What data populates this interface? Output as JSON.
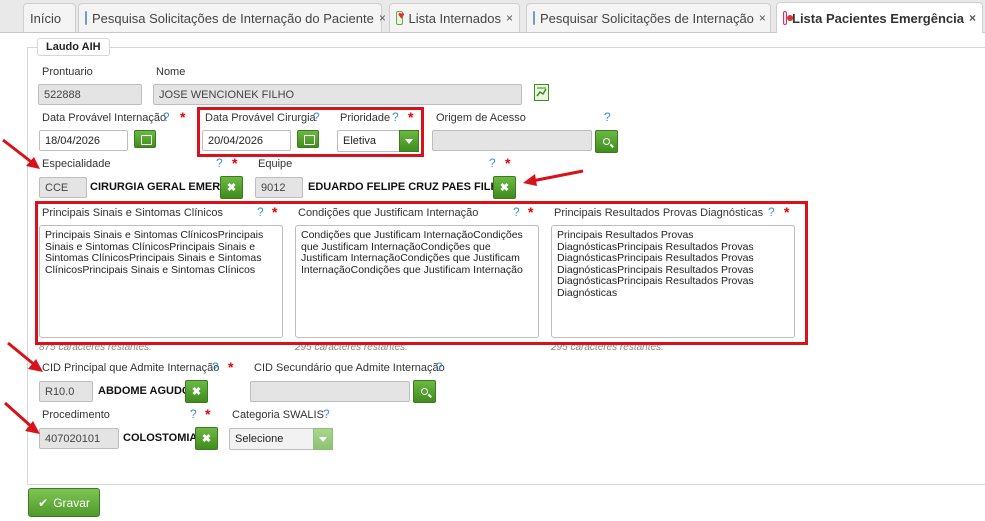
{
  "tabs": [
    {
      "label": "Início"
    },
    {
      "label": "Pesquisa Solicitações de Internação do Paciente",
      "close": "×"
    },
    {
      "label": "Lista Internados",
      "close": "×"
    },
    {
      "label": "Pesquisar Solicitações de Internação",
      "close": "×"
    },
    {
      "label": "Lista Pacientes Emergência",
      "close": "×"
    }
  ],
  "form": {
    "legend": "Laudo AIH",
    "prontuario": {
      "label": "Prontuario",
      "value": "522888"
    },
    "nome": {
      "label": "Nome",
      "value": "JOSE WENCIONEK FILHO"
    },
    "data_internacao": {
      "label": "Data Provável Internação",
      "value": "18/04/2026"
    },
    "data_cirurgia": {
      "label": "Data Provável Cirurgia",
      "value": "20/04/2026"
    },
    "prioridade": {
      "label": "Prioridade",
      "value": "Eletiva"
    },
    "origem": {
      "label": "Origem de Acesso",
      "value": ""
    },
    "especialidade": {
      "label": "Especialidade",
      "code": "CCE",
      "name": "CIRURGIA GERAL EMERG"
    },
    "equipe": {
      "label": "Equipe",
      "code": "9012",
      "name": "EDUARDO FELIPE CRUZ PAES FILHO"
    },
    "sinais": {
      "label": "Principais Sinais e Sintomas Clínicos",
      "value": "Principais Sinais e Sintomas ClínicosPrincipais Sinais e Sintomas ClínicosPrincipais Sinais e Sintomas ClínicosPrincipais Sinais e Sintomas ClínicosPrincipais Sinais e Sintomas Clínicos",
      "chars": "875 caracteres restantes."
    },
    "condicoes": {
      "label": "Condições que Justificam Internação",
      "value": "Condições que Justificam InternaçãoCondições que Justificam InternaçãoCondições que Justificam InternaçãoCondições que Justificam InternaçãoCondições que Justificam Internação",
      "chars": "295 caracteres restantes."
    },
    "provas": {
      "label": "Principais Resultados Provas Diagnósticas",
      "value": "Principais Resultados Provas DiagnósticasPrincipais Resultados Provas DiagnósticasPrincipais Resultados Provas DiagnósticasPrincipais Resultados Provas DiagnósticasPrincipais Resultados Provas Diagnósticas",
      "chars": "295 caracteres restantes."
    },
    "cid_principal": {
      "label": "CID Principal que Admite Internação",
      "code": "R10.0",
      "name": "ABDOME AGUDO"
    },
    "cid_secundario": {
      "label": "CID Secundário que Admite Internação",
      "value": ""
    },
    "procedimento": {
      "label": "Procedimento",
      "code": "407020101",
      "name": "COLOSTOMIA"
    },
    "swalis": {
      "label": "Categoria SWALIS",
      "value": "Selecione"
    },
    "help": "?",
    "required": "*",
    "clear": "✖"
  },
  "save_label": "Gravar",
  "colors": {
    "annotation_red": "#d9111b",
    "button_green": "#4f9b2b",
    "help_blue": "#3a8fd8"
  }
}
